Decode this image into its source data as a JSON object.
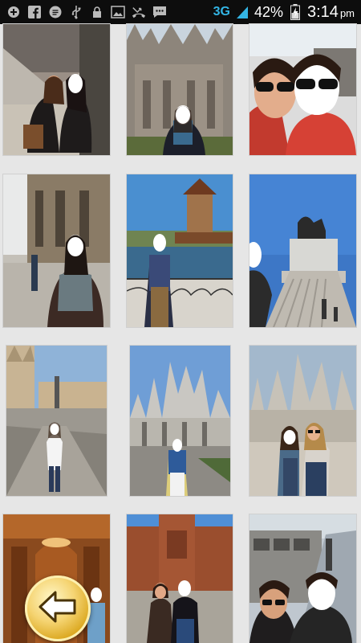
{
  "status_bar": {
    "left_icons": [
      "add-icon",
      "facebook-icon",
      "chat-bubble-icon",
      "usb-icon",
      "lock-icon",
      "image-icon",
      "missed-call-icon",
      "message-icon"
    ],
    "network": "3G",
    "battery_percent": "42%",
    "time": "3:14",
    "ampm": "pm"
  },
  "photos": [
    {
      "name": "photo-tile-1"
    },
    {
      "name": "photo-tile-2"
    },
    {
      "name": "photo-tile-3"
    },
    {
      "name": "photo-tile-4"
    },
    {
      "name": "photo-tile-5"
    },
    {
      "name": "photo-tile-6"
    },
    {
      "name": "photo-tile-7"
    },
    {
      "name": "photo-tile-8"
    },
    {
      "name": "photo-tile-9"
    },
    {
      "name": "photo-tile-10"
    },
    {
      "name": "photo-tile-11"
    },
    {
      "name": "photo-tile-12"
    }
  ],
  "back_button": {
    "icon": "arrow-left-icon"
  }
}
